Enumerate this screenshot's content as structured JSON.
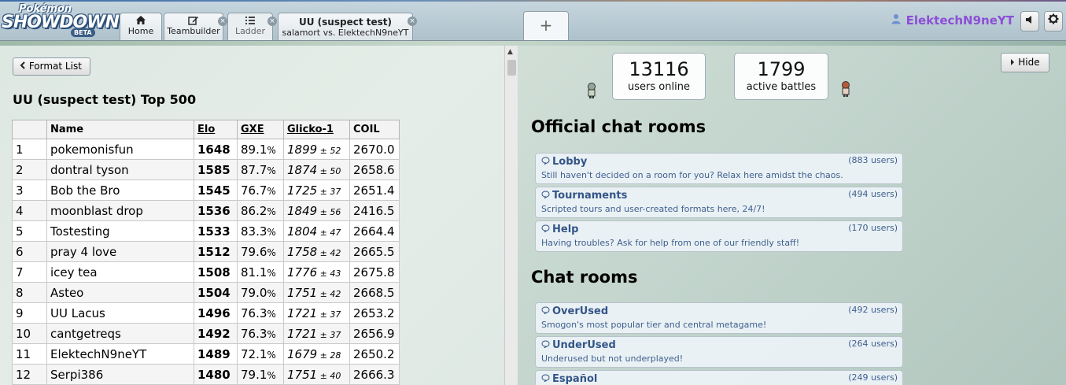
{
  "app": {
    "logo_top": "Pokémon",
    "logo_main": "SHOWDOWN",
    "logo_badge": "BETA"
  },
  "tabs": {
    "home_label": "Home",
    "teambuilder_label": "Teambuilder",
    "ladder_label": "Ladder",
    "battle_title": "UU (suspect test)",
    "battle_players": "salamort vs. ElektechN9neYT",
    "new_tab_label": "+",
    "close_glyph": "×"
  },
  "user": {
    "name": "ElektechN9neYT"
  },
  "ladder": {
    "format_button": "Format List",
    "title": "UU (suspect test) Top 500",
    "columns": [
      "",
      "Name",
      "Elo",
      "GXE",
      "Glicko-1",
      "COIL"
    ],
    "rows": [
      {
        "rank": "1",
        "name": "pokemonisfun",
        "elo": "1648",
        "gxe": "89.1",
        "glicko": "1899",
        "dev": "52",
        "coil": "2670.0"
      },
      {
        "rank": "2",
        "name": "dontral tyson",
        "elo": "1585",
        "gxe": "87.7",
        "glicko": "1874",
        "dev": "50",
        "coil": "2658.6"
      },
      {
        "rank": "3",
        "name": "Bob the Bro",
        "elo": "1545",
        "gxe": "76.7",
        "glicko": "1725",
        "dev": "37",
        "coil": "2651.4"
      },
      {
        "rank": "4",
        "name": "moonblast drop",
        "elo": "1536",
        "gxe": "86.2",
        "glicko": "1849",
        "dev": "56",
        "coil": "2416.5"
      },
      {
        "rank": "5",
        "name": "Tostesting",
        "elo": "1533",
        "gxe": "83.3",
        "glicko": "1804",
        "dev": "47",
        "coil": "2664.4"
      },
      {
        "rank": "6",
        "name": "pray 4 love",
        "elo": "1512",
        "gxe": "79.6",
        "glicko": "1758",
        "dev": "42",
        "coil": "2665.5"
      },
      {
        "rank": "7",
        "name": "icey tea",
        "elo": "1508",
        "gxe": "81.1",
        "glicko": "1776",
        "dev": "43",
        "coil": "2675.8"
      },
      {
        "rank": "8",
        "name": "Asteo",
        "elo": "1504",
        "gxe": "79.0",
        "glicko": "1751",
        "dev": "42",
        "coil": "2668.5"
      },
      {
        "rank": "9",
        "name": "UU Lacus",
        "elo": "1496",
        "gxe": "76.3",
        "glicko": "1721",
        "dev": "37",
        "coil": "2653.2"
      },
      {
        "rank": "10",
        "name": "cantgetreqs",
        "elo": "1492",
        "gxe": "76.3",
        "glicko": "1721",
        "dev": "37",
        "coil": "2656.9"
      },
      {
        "rank": "11",
        "name": "ElektechN9neYT",
        "elo": "1489",
        "gxe": "72.1",
        "glicko": "1679",
        "dev": "28",
        "coil": "2650.2"
      },
      {
        "rank": "12",
        "name": "Serpi386",
        "elo": "1480",
        "gxe": "79.1",
        "glicko": "1751",
        "dev": "40",
        "coil": "2666.3"
      }
    ]
  },
  "stats": {
    "users_count": "13116",
    "users_label": "users online",
    "battles_count": "1799",
    "battles_label": "active battles"
  },
  "rooms": {
    "hide_button": "Hide",
    "official_heading": "Official chat rooms",
    "chat_heading": "Chat rooms",
    "official": [
      {
        "name": "Lobby",
        "users": "(883 users)",
        "desc": "Still haven't decided on a room for you? Relax here amidst the chaos."
      },
      {
        "name": "Tournaments",
        "users": "(494 users)",
        "desc": "Scripted tours and user-created formats here, 24/7!"
      },
      {
        "name": "Help",
        "users": "(170 users)",
        "desc": "Having troubles? Ask for help from one of our friendly staff!"
      }
    ],
    "chat": [
      {
        "name": "OverUsed",
        "users": "(492 users)",
        "desc": "Smogon's most popular tier and central metagame!"
      },
      {
        "name": "UnderUsed",
        "users": "(264 users)",
        "desc": "Underused but not underplayed!"
      },
      {
        "name": "Español",
        "users": "(249 users)",
        "desc": ""
      }
    ]
  },
  "colors": {
    "username": "#8c4fd6",
    "room_text": "#335588"
  },
  "icons": [
    "home-icon",
    "edit-icon",
    "list-icon",
    "close-icon",
    "user-icon",
    "sound-icon",
    "gear-icon",
    "chevron-left-icon",
    "caret-right-icon",
    "chat-bubble-icon"
  ]
}
